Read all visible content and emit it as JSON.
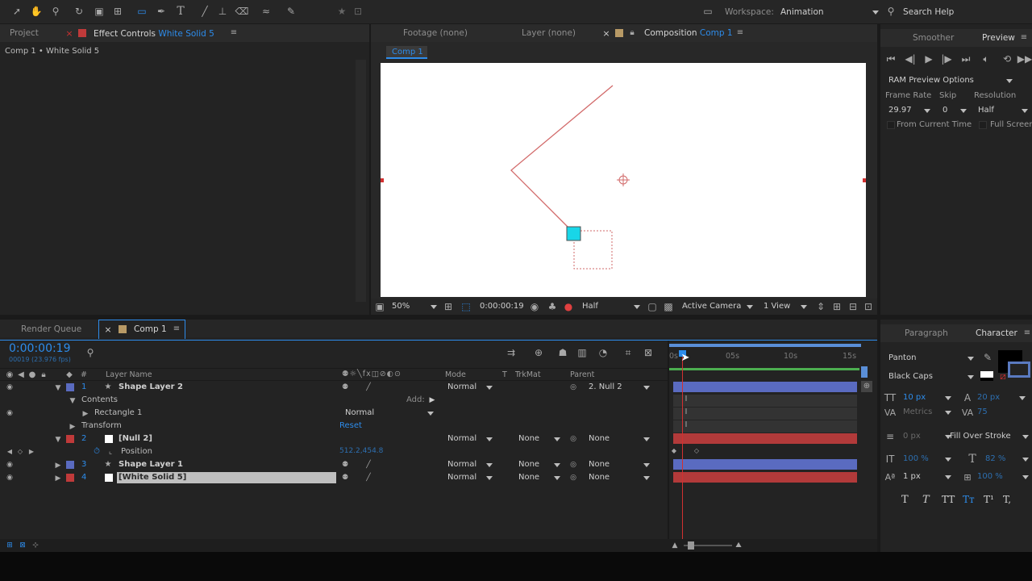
{
  "toolbar": {
    "workspace_label": "Workspace:",
    "workspace_value": "Animation",
    "search_help": "Search Help"
  },
  "left_panel": {
    "project_tab": "Project",
    "effect_controls_tab": "Effect Controls",
    "effect_controls_target": "White Solid 5",
    "breadcrumb": "Comp 1 • White Solid 5"
  },
  "viewer": {
    "footage_tab": "Footage",
    "footage_state": "(none)",
    "layer_tab": "Layer",
    "layer_state": "(none)",
    "composition_tab": "Composition",
    "composition_name": "Comp 1",
    "comp_button": "Comp 1",
    "zoom": "50%",
    "timecode": "0:00:00:19",
    "resolution": "Half",
    "camera": "Active Camera",
    "views": "1 View"
  },
  "preview": {
    "smoother_tab": "Smoother",
    "preview_tab": "Preview",
    "ram_options": "RAM Preview Options",
    "frame_rate_label": "Frame Rate",
    "skip_label": "Skip",
    "resolution_label": "Resolution",
    "frame_rate": "29.97",
    "skip": "0",
    "resolution": "Half",
    "from_current_time": "From Current Time",
    "full_screen": "Full Screen"
  },
  "timeline": {
    "render_queue_tab": "Render Queue",
    "comp_tab": "Comp 1",
    "timecode": "0:00:00:19",
    "fps_info": "00019 (23.976 fps)",
    "headers": {
      "hash": "#",
      "layer_name": "Layer Name",
      "mode": "Mode",
      "t": "T",
      "trkmat": "TrkMat",
      "parent": "Parent"
    },
    "ruler": {
      "t0": "0s",
      "t5": "05s",
      "t10": "10s",
      "t15": "15s"
    },
    "layers": [
      {
        "num": "1",
        "name": "Shape Layer 2",
        "mode": "Normal",
        "trkmat": "",
        "parent": "2. Null 2"
      },
      {
        "num": "2",
        "name": "[Null 2]",
        "mode": "Normal",
        "trkmat": "None",
        "parent": "None"
      },
      {
        "num": "3",
        "name": "Shape Layer 1",
        "mode": "Normal",
        "trkmat": "None",
        "parent": "None"
      },
      {
        "num": "4",
        "name": "[White Solid 5]",
        "mode": "Normal",
        "trkmat": "None",
        "parent": "None"
      }
    ],
    "contents_label": "Contents",
    "add_label": "Add:",
    "rectangle_label": "Rectangle 1",
    "rectangle_mode": "Normal",
    "transform_label": "Transform",
    "reset_label": "Reset",
    "position_label": "Position",
    "position_value": "512.2,454.8"
  },
  "character": {
    "paragraph_tab": "Paragraph",
    "character_tab": "Character",
    "font_family": "Panton",
    "font_style": "Black Caps",
    "font_size": "10 px",
    "leading": "20 px",
    "kerning": "Metrics",
    "tracking": "75",
    "stroke_width": "0 px",
    "stroke_type": "Fill Over Stroke",
    "vscale": "100 %",
    "hscale": "82 %",
    "baseline": "1 px",
    "tsume": "100 %",
    "style_buttons": [
      "T",
      "T",
      "TT",
      "Tт",
      "T¹",
      "T,"
    ]
  },
  "colors": {
    "accent_blue": "#2d8ceb",
    "layer_blue": "#5a6bc0",
    "layer_red": "#b23a3a",
    "cyan_handle": "#18d6e8",
    "path_red": "#d26a6a"
  }
}
